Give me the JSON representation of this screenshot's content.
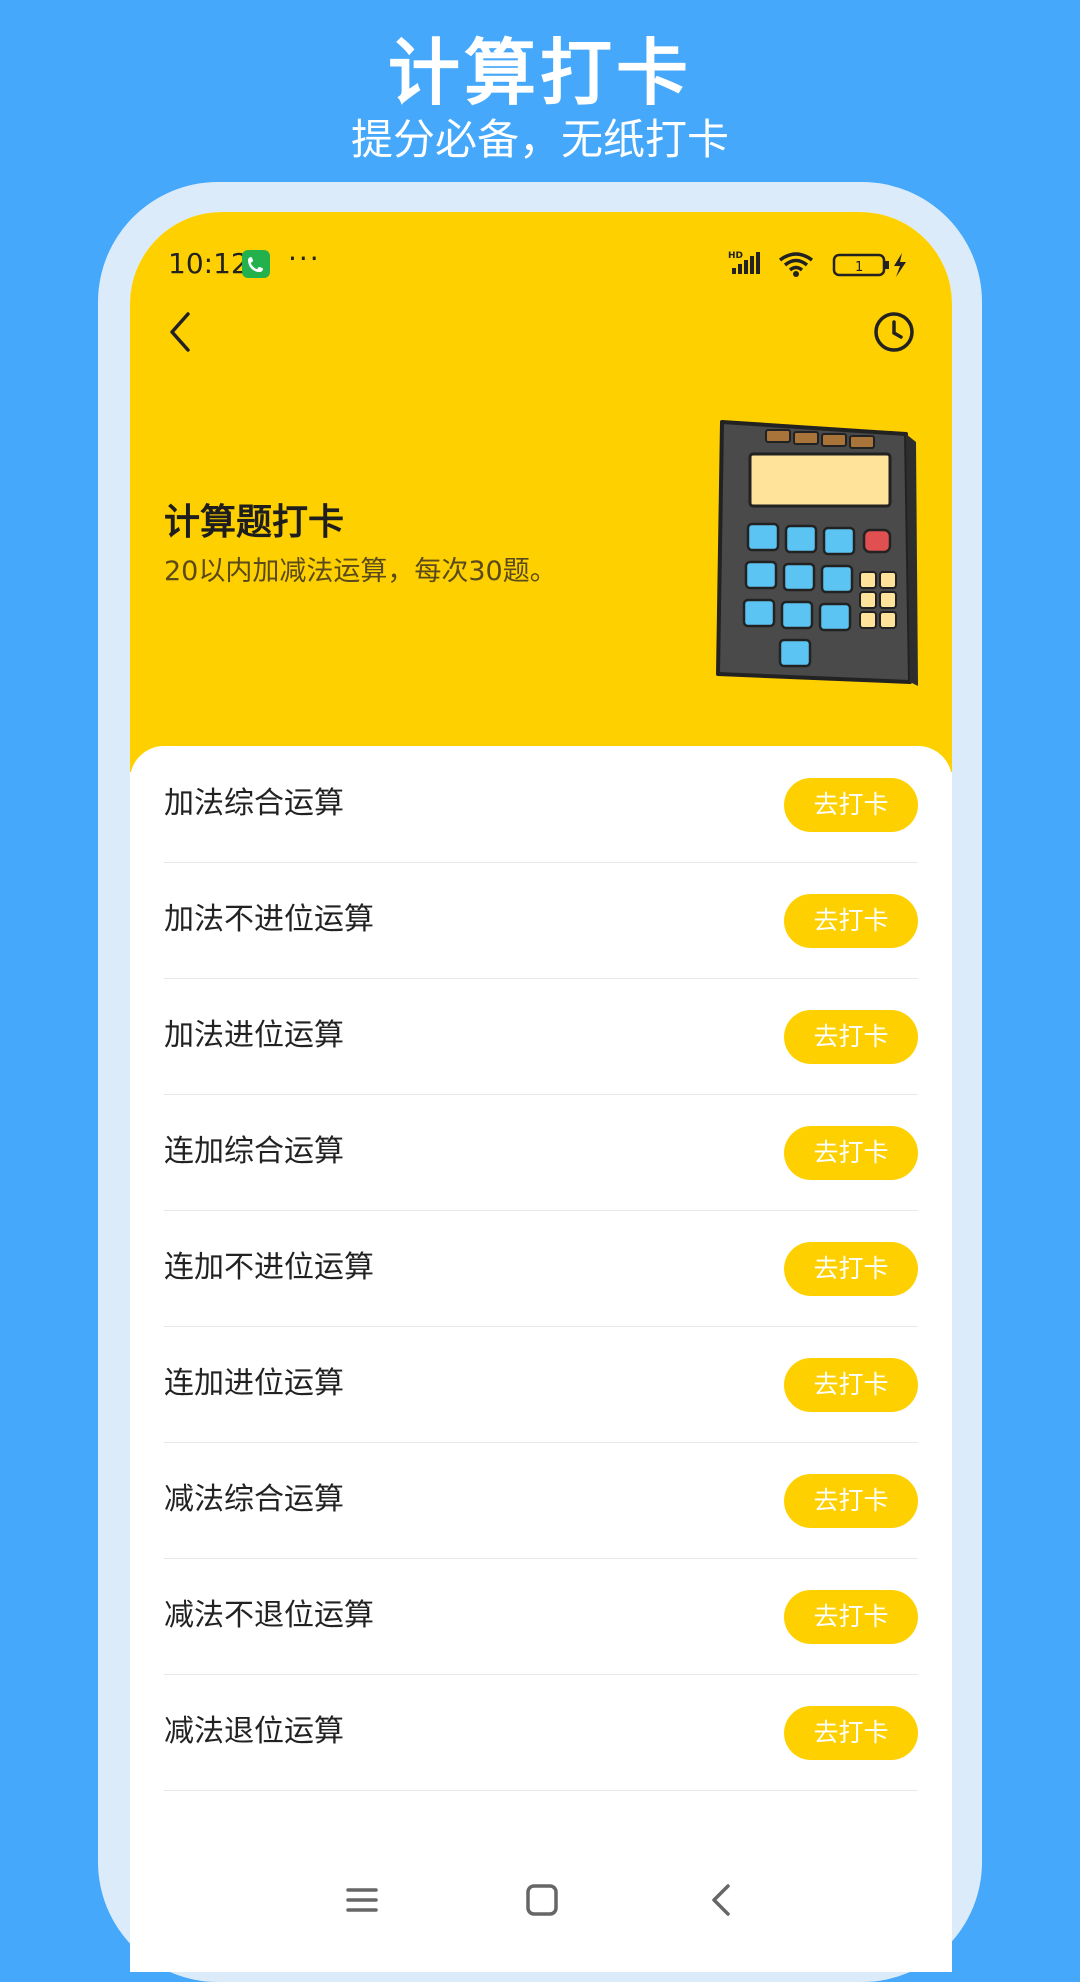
{
  "promo": {
    "title": "计算打卡",
    "subtitle": "提分必备，无纸打卡"
  },
  "status_bar": {
    "time": "10:12",
    "more": "···",
    "network": "HD",
    "battery_level": "1"
  },
  "header": {
    "title": "计算题打卡",
    "description": "20以内加减法运算，每次30题。"
  },
  "items": [
    {
      "label": "加法综合运算",
      "button": "去打卡"
    },
    {
      "label": "加法不进位运算",
      "button": "去打卡"
    },
    {
      "label": "加法进位运算",
      "button": "去打卡"
    },
    {
      "label": "连加综合运算",
      "button": "去打卡"
    },
    {
      "label": "连加不进位运算",
      "button": "去打卡"
    },
    {
      "label": "连加进位运算",
      "button": "去打卡"
    },
    {
      "label": "减法综合运算",
      "button": "去打卡"
    },
    {
      "label": "减法不退位运算",
      "button": "去打卡"
    },
    {
      "label": "减法退位运算",
      "button": "去打卡"
    }
  ],
  "colors": {
    "background": "#45A8FB",
    "accent": "#FFD000",
    "frame": "#DCEBFA"
  },
  "icons": {
    "back": "chevron-left-icon",
    "history": "clock-icon",
    "nav_menu": "menu-icon",
    "nav_home": "home-square-icon",
    "nav_back": "back-icon"
  }
}
